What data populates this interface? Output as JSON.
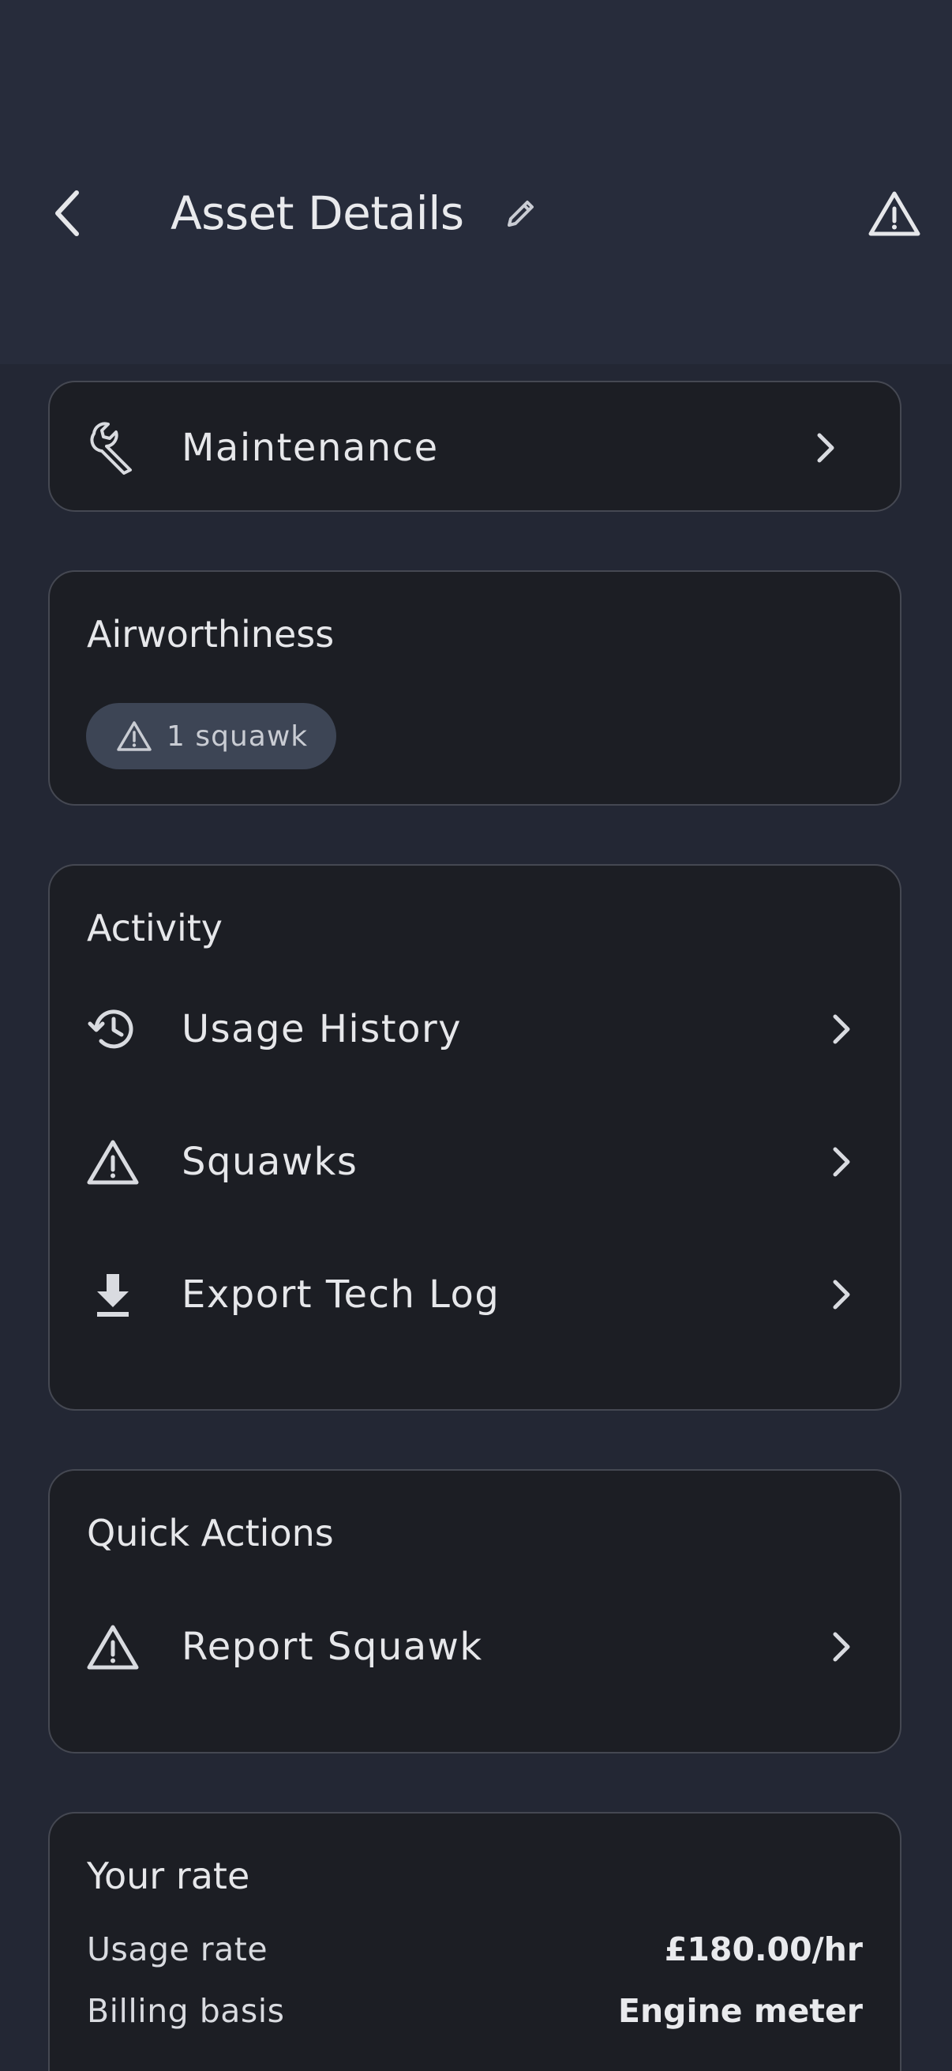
{
  "header": {
    "title": "Asset Details"
  },
  "maintenance": {
    "label": "Maintenance"
  },
  "airworthiness": {
    "title": "Airworthiness",
    "chip_label": "1 squawk"
  },
  "activity": {
    "title": "Activity",
    "items": [
      {
        "label": "Usage History",
        "icon": "history-icon"
      },
      {
        "label": "Squawks",
        "icon": "warning-icon"
      },
      {
        "label": "Export Tech Log",
        "icon": "download-icon"
      }
    ]
  },
  "quick_actions": {
    "title": "Quick Actions",
    "items": [
      {
        "label": "Report Squawk",
        "icon": "warning-icon"
      }
    ]
  },
  "rate": {
    "title": "Your rate",
    "rows": [
      {
        "key": "Usage rate",
        "value": "£180.00/hr"
      },
      {
        "key": "Billing basis",
        "value": "Engine meter"
      }
    ]
  },
  "colors": {
    "background": "#232734",
    "header": "#272c3b",
    "card": "#1c1e24",
    "card_border": "#454852",
    "chip": "#3d4555",
    "text": "#e6e7ea"
  }
}
